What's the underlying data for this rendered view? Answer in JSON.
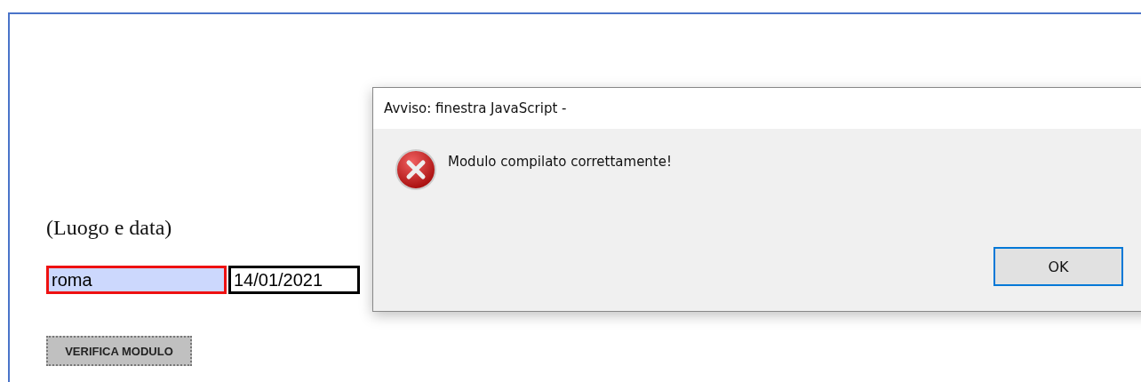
{
  "form": {
    "label": "(Luogo e data)",
    "fields": [
      {
        "value": "roma",
        "invalid": true
      },
      {
        "value": "14/01/2021",
        "invalid": false
      }
    ],
    "button": "VERIFICA MODULO"
  },
  "dialog": {
    "title": "Avviso: finestra JavaScript -",
    "kind": "error",
    "message": "Modulo compilato correttamente!",
    "buttons": [
      {
        "label": "OK",
        "selected": true
      }
    ]
  }
}
